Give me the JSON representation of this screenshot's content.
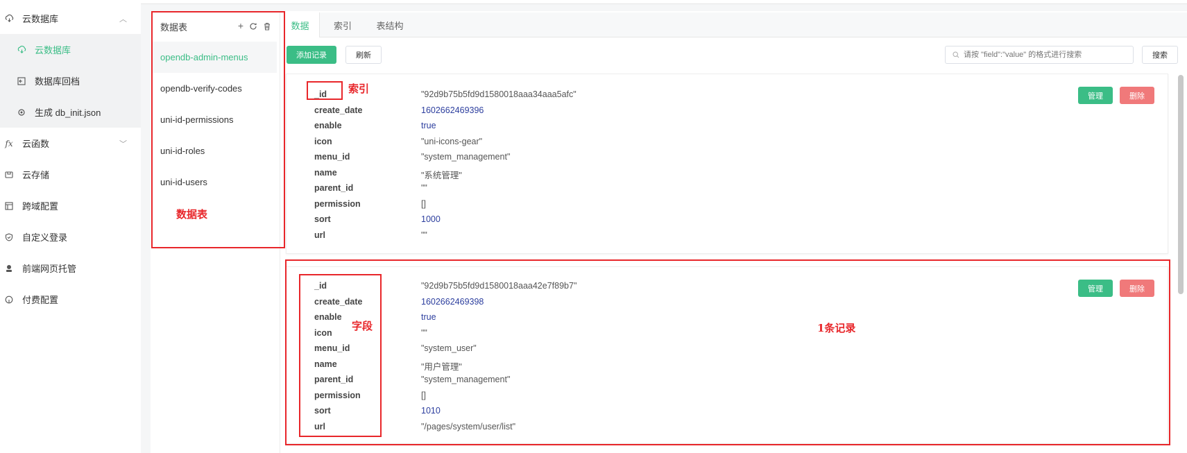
{
  "nav": {
    "items": [
      {
        "label": "云数据库",
        "icon": "cloud-database-icon",
        "chevron": "up"
      },
      {
        "label": "云数据库",
        "icon": "cloud-database-icon",
        "sub": true,
        "active": true
      },
      {
        "label": "数据库回档",
        "icon": "rollback-icon",
        "sub": true
      },
      {
        "label": "生成 db_init.json",
        "icon": "generate-icon",
        "sub": true
      },
      {
        "label": "云函数",
        "icon": "fx-icon",
        "chevron": "down"
      },
      {
        "label": "云存储",
        "icon": "storage-icon"
      },
      {
        "label": "跨域配置",
        "icon": "cross-domain-icon"
      },
      {
        "label": "自定义登录",
        "icon": "shield-icon"
      },
      {
        "label": "前端网页托管",
        "icon": "hosting-icon"
      },
      {
        "label": "付费配置",
        "icon": "payment-icon"
      }
    ]
  },
  "tables": {
    "title": "数据表",
    "items": [
      "opendb-admin-menus",
      "opendb-verify-codes",
      "uni-id-permissions",
      "uni-id-roles",
      "uni-id-users"
    ],
    "active_index": 0
  },
  "tabs": [
    "数据",
    "索引",
    "表结构"
  ],
  "toolbar": {
    "add_label": "添加记录",
    "refresh_label": "刷新",
    "search_placeholder": "请按 \"field\":\"value\" 的格式进行搜索",
    "search_label": "搜索"
  },
  "record_actions": {
    "manage_label": "管理",
    "delete_label": "删除"
  },
  "records": [
    {
      "fields": [
        {
          "key": "_id",
          "value": "\"92d9b75b5fd9d1580018aaa34aaa5afc\"",
          "type": "string"
        },
        {
          "key": "create_date",
          "value": "1602662469396",
          "type": "number"
        },
        {
          "key": "enable",
          "value": "true",
          "type": "bool"
        },
        {
          "key": "icon",
          "value": "\"uni-icons-gear\"",
          "type": "string"
        },
        {
          "key": "menu_id",
          "value": "\"system_management\"",
          "type": "string"
        },
        {
          "key": "name",
          "value": "\"系统管理\"",
          "type": "string"
        },
        {
          "key": "parent_id",
          "value": "\"\"",
          "type": "string"
        },
        {
          "key": "permission",
          "value": "[]",
          "type": "string"
        },
        {
          "key": "sort",
          "value": "1000",
          "type": "number"
        },
        {
          "key": "url",
          "value": "\"\"",
          "type": "string"
        }
      ]
    },
    {
      "fields": [
        {
          "key": "_id",
          "value": "\"92d9b75b5fd9d1580018aaa42e7f89b7\"",
          "type": "string"
        },
        {
          "key": "create_date",
          "value": "1602662469398",
          "type": "number"
        },
        {
          "key": "enable",
          "value": "true",
          "type": "bool"
        },
        {
          "key": "icon",
          "value": "\"\"",
          "type": "string"
        },
        {
          "key": "menu_id",
          "value": "\"system_user\"",
          "type": "string"
        },
        {
          "key": "name",
          "value": "\"用户管理\"",
          "type": "string"
        },
        {
          "key": "parent_id",
          "value": "\"system_management\"",
          "type": "string"
        },
        {
          "key": "permission",
          "value": "[]",
          "type": "string"
        },
        {
          "key": "sort",
          "value": "1010",
          "type": "number"
        },
        {
          "key": "url",
          "value": "\"/pages/system/user/list\"",
          "type": "string"
        }
      ]
    }
  ],
  "annotations": {
    "tables": "数据表",
    "index": "索引",
    "field": "字段",
    "record": "1条记录"
  },
  "colors": {
    "accent": "#3bbd86",
    "danger": "#f0797a",
    "annotation": "#e8262a",
    "number": "#2c3e9e"
  }
}
